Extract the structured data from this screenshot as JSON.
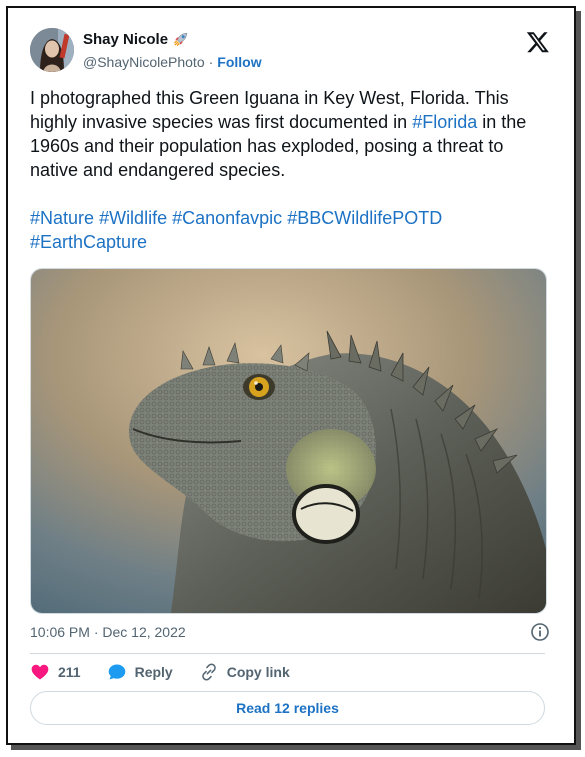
{
  "author": {
    "name": "Shay Nicole",
    "handle": "@ShayNicolePhoto",
    "follow_label": "Follow",
    "separator": "·"
  },
  "tweet": {
    "text_before_tag": "I photographed this Green Iguana in Key West, Florida. This highly invasive species was first documented in ",
    "inline_tag": "#Florida",
    "text_after_tag": " in the 1960s and their population has exploded, posing a threat to native and endangered species.",
    "hashtags": [
      "#Nature",
      "#Wildlife",
      "#Canonfavpic",
      "#BBCWildlifePOTD",
      "#EarthCapture"
    ]
  },
  "media": {
    "subject": "Green Iguana"
  },
  "meta": {
    "timestamp": "10:06 PM · Dec 12, 2022"
  },
  "actions": {
    "like_count": "211",
    "reply_label": "Reply",
    "copy_link_label": "Copy link",
    "read_replies_label": "Read 12 replies"
  },
  "colors": {
    "link": "#1d72c4",
    "like": "#f91880",
    "reply": "#1d9bf0",
    "muted": "#536471"
  },
  "icons": {
    "author_badge": "rocket-icon",
    "brand": "x-logo-icon",
    "info": "info-icon",
    "like": "heart-icon",
    "reply": "reply-bubble-icon",
    "copy": "link-icon"
  }
}
